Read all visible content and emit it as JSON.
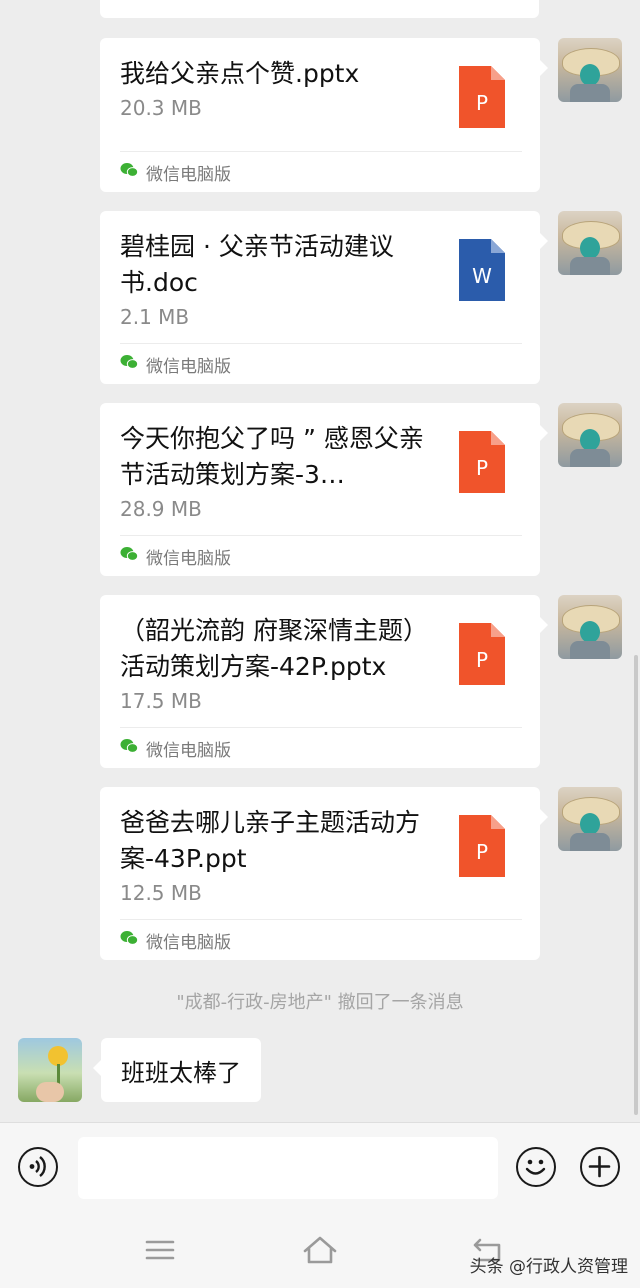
{
  "messages": [
    {
      "file_name": "我给父亲点个赞.pptx",
      "file_size": "20.3 MB",
      "file_type": "P",
      "icon_color": "#f0542b",
      "source": "微信电脑版"
    },
    {
      "file_name": "碧桂园 · 父亲节活动建议书.doc",
      "file_size": "2.1 MB",
      "file_type": "W",
      "icon_color": "#2b5cab",
      "source": "微信电脑版"
    },
    {
      "file_name": "今天你抱父了吗 ” 感恩父亲节活动策划方案-3…",
      "file_size": "28.9 MB",
      "file_type": "P",
      "icon_color": "#f0542b",
      "source": "微信电脑版"
    },
    {
      "file_name": "（韶光流韵 府聚深情主题）活动策划方案-42P.pptx",
      "file_size": "17.5 MB",
      "file_type": "P",
      "icon_color": "#f0542b",
      "source": "微信电脑版"
    },
    {
      "file_name": "爸爸去哪儿亲子主题活动方案-43P.ppt",
      "file_size": "12.5 MB",
      "file_type": "P",
      "icon_color": "#f0542b",
      "source": "微信电脑版"
    }
  ],
  "system_note": "\"成都-行政-房地产\" 撤回了一条消息",
  "incoming_message": "班班太棒了",
  "input": {
    "value": ""
  },
  "watermark": "头条 @行政人资管理",
  "colors": {
    "background": "#ededed",
    "wechat_green": "#3cb034",
    "ppt_red": "#f0542b",
    "word_blue": "#2b5cab"
  },
  "icons": [
    "voice-icon",
    "emoji-icon",
    "plus-icon",
    "menu-icon",
    "home-icon",
    "back-icon"
  ]
}
